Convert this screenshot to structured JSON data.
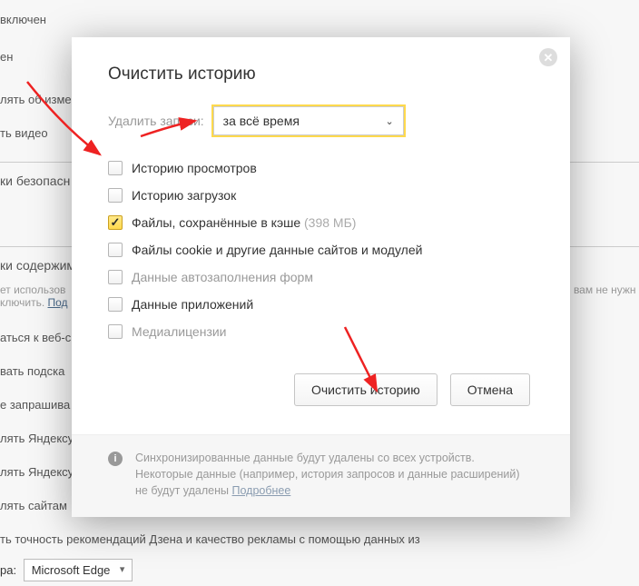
{
  "background": {
    "lines": [
      "включен",
      "ен",
      "лять об изме",
      "ть видео",
      "ки безопасн",
      "ки содержим"
    ],
    "privacy_prefix": "ет использов",
    "privacy_text": "жности вам не нужн",
    "privacy_off": "ключить.",
    "privacy_link": "Под",
    "lines2": [
      "аться к веб-с",
      "вать подска",
      "е запрашива",
      "лять Яндексу",
      "лять Яндексу",
      "лять сайтам"
    ],
    "zen_text": "ть точность рекомендаций Дзена и качество рекламы с помощью данных из",
    "browser_label": "ра:",
    "browser_value": "Microsoft Edge"
  },
  "modal": {
    "title": "Очистить историю",
    "close_label": "✕",
    "timerange_label": "Удалить записи:",
    "timerange_value": "за всё время",
    "items": [
      {
        "label": "Историю просмотров",
        "checked": false,
        "dim": false,
        "suffix": ""
      },
      {
        "label": "Историю загрузок",
        "checked": false,
        "dim": false,
        "suffix": ""
      },
      {
        "label": "Файлы, сохранённые в кэше",
        "checked": true,
        "dim": false,
        "suffix": "(398 МБ)"
      },
      {
        "label": "Файлы cookie и другие данные сайтов и модулей",
        "checked": false,
        "dim": false,
        "suffix": ""
      },
      {
        "label": "Данные автозаполнения форм",
        "checked": false,
        "dim": true,
        "suffix": ""
      },
      {
        "label": "Данные приложений",
        "checked": false,
        "dim": false,
        "suffix": ""
      },
      {
        "label": "Медиалицензии",
        "checked": false,
        "dim": true,
        "suffix": ""
      }
    ],
    "clear_btn": "Очистить историю",
    "cancel_btn": "Отмена",
    "footer_text": "Синхронизированные данные будут удалены со всех устройств. Некоторые данные (например, история запросов и данные расширений) не будут удалены",
    "footer_link": "Подробнее"
  }
}
